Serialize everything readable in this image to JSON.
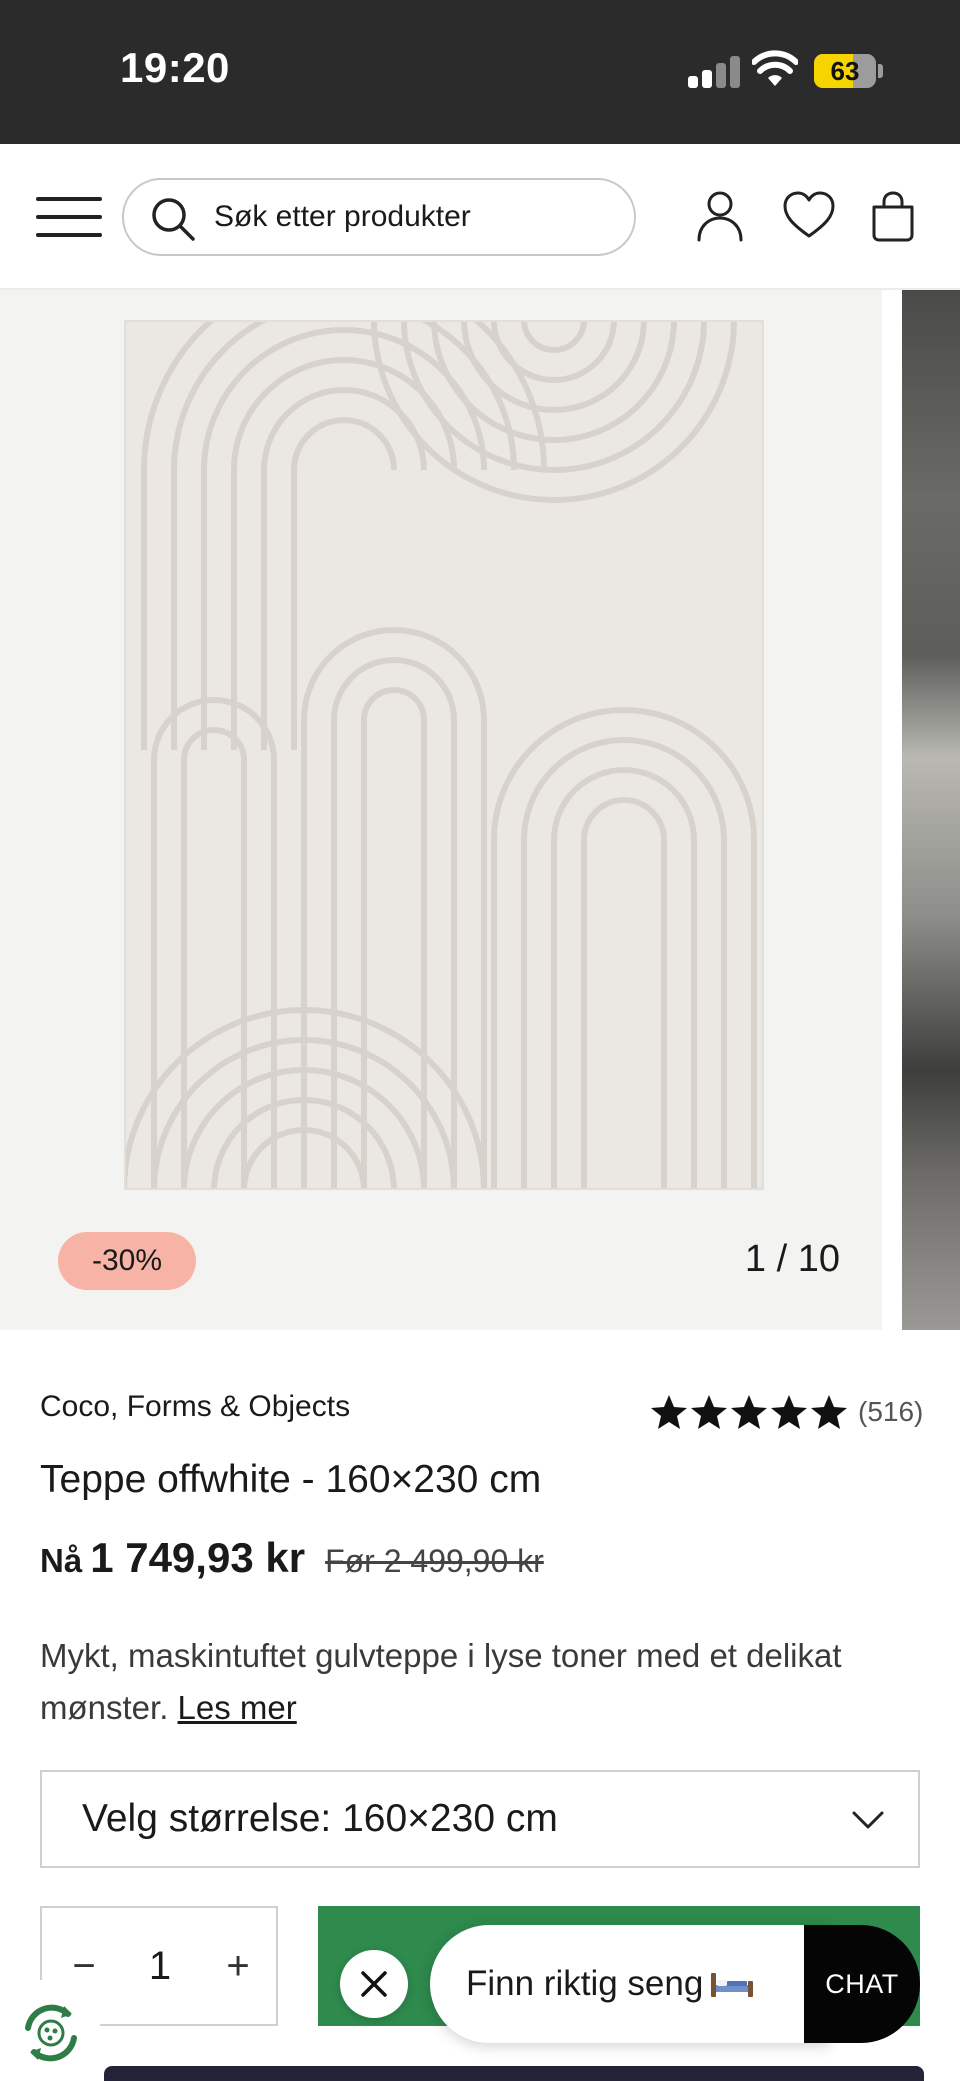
{
  "status_bar": {
    "time": "19:20",
    "battery_level": "63",
    "battery_fraction": 0.63
  },
  "header": {
    "search_placeholder": "Søk etter produkter",
    "icons": [
      "menu-icon",
      "search-icon",
      "account-icon",
      "wishlist-heart-icon",
      "cart-bag-icon"
    ]
  },
  "gallery": {
    "discount_badge": "-30%",
    "slide_counter": "1 / 10"
  },
  "product": {
    "brand": "Coco, Forms & Objects",
    "rating_stars": 5,
    "review_count": "(516)",
    "title": "Teppe offwhite - 160×230 cm",
    "price_now_label": "Nå",
    "price_now": "1 749,93 kr",
    "price_before": "Før 2 499,90 kr",
    "description": "Mykt, maskintuftet gulvteppe i lyse toner med et delikat mønster.",
    "read_more": "Les mer"
  },
  "size_select": {
    "label": "Velg størrelse: 160×230 cm"
  },
  "quantity": {
    "minus": "−",
    "value": "1",
    "plus": "+"
  },
  "assistant": {
    "prompt": "Finn riktig seng",
    "chat_label": "CHAT"
  },
  "colors": {
    "status_bar_bg": "#2b2b2b",
    "discount_badge": "#f6b3a6",
    "add_to_cart_green": "#2e8a4d",
    "chat_button": "#050505"
  }
}
